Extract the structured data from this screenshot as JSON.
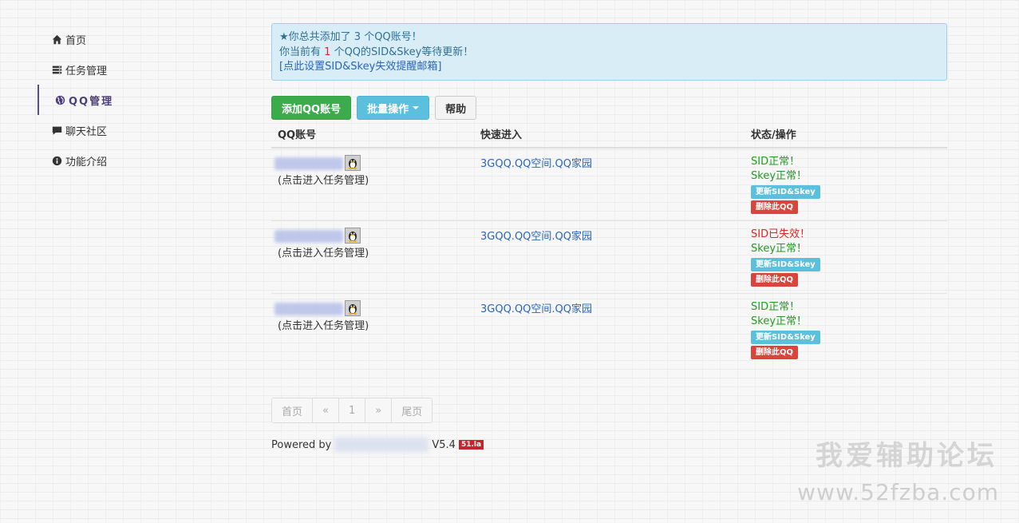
{
  "sidebar": {
    "items": [
      {
        "label": "首页",
        "icon": "home-icon"
      },
      {
        "label": "任务管理",
        "icon": "tasks-icon"
      },
      {
        "label": "QQ管理",
        "icon": "globe-icon",
        "active": true
      },
      {
        "label": "聊天社区",
        "icon": "comment-icon"
      },
      {
        "label": "功能介绍",
        "icon": "info-icon"
      }
    ]
  },
  "alert": {
    "line1": "★你总共添加了 3 个QQ账号！",
    "line2_pre": "你当前有",
    "line2_count": "1",
    "line2_post": "个QQ的SID&Skey等待更新！",
    "link": "[点此设置SID&Skey失效提醒邮箱]"
  },
  "toolbar": {
    "add_label": "添加QQ账号",
    "batch_label": "批量操作",
    "help_label": "帮助"
  },
  "table": {
    "headers": [
      "QQ账号",
      "快速进入",
      "状态/操作"
    ],
    "rows": [
      {
        "sub": "(点击进入任务管理)",
        "quick_link": "3GQQ.QQ空间.QQ家园",
        "sid_status": "SID正常！",
        "skey_status": "Skey正常！",
        "update_label": "更新SID&Skey",
        "delete_label": "删除此QQ"
      },
      {
        "sub": "(点击进入任务管理)",
        "quick_link": "3GQQ.QQ空间.QQ家园",
        "sid_status": "SID已失效！",
        "skey_status": "Skey正常！",
        "update_label": "更新SID&Skey",
        "delete_label": "删除此QQ"
      },
      {
        "sub": "(点击进入任务管理)",
        "quick_link": "3GQQ.QQ空间.QQ家园",
        "sid_status": "SID正常！",
        "skey_status": "Skey正常！",
        "update_label": "更新SID&Skey",
        "delete_label": "删除此QQ"
      }
    ]
  },
  "pager": {
    "first": "首页",
    "prev": "«",
    "current": "1",
    "next": "»",
    "last": "尾页"
  },
  "footer": {
    "powered": "Powered by",
    "version": "V5.4",
    "badge": "51.la"
  },
  "watermark": {
    "line1": "我爱辅助论坛",
    "line2": "www.52fzba.com"
  },
  "colors": {
    "accent_green": "#3cab4c",
    "accent_blue": "#5bc0de",
    "danger": "#d9453b",
    "ok_text": "#229b22",
    "bad_text": "#e02424"
  }
}
